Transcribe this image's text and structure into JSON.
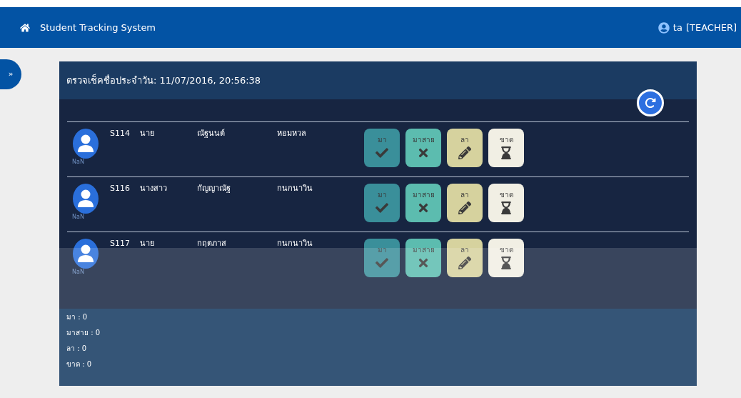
{
  "navbar": {
    "title": "Student Tracking System",
    "user": "ta",
    "role": "[TEACHER]"
  },
  "sidebar_toggle": {
    "label": "»"
  },
  "card": {
    "title": "ตรวจเช็คชื่อประจำวัน: 11/07/2016, 20:56:38"
  },
  "students": [
    {
      "id": "S114",
      "prefix": "นาย",
      "first_name": "ณัฐนนต์",
      "last_name": "หอมหวล",
      "avatar_caption": "NaN",
      "actions": [
        {
          "kind": "present",
          "label": "มา"
        },
        {
          "kind": "late",
          "label": "มาสาย"
        },
        {
          "kind": "leave",
          "label": "ลา"
        },
        {
          "kind": "absent",
          "label": "ขาด"
        }
      ]
    },
    {
      "id": "S116",
      "prefix": "นางสาว",
      "first_name": "กัญญาณัฐ",
      "last_name": "กนกนาวิน",
      "avatar_caption": "NaN",
      "actions": [
        {
          "kind": "present",
          "label": "มา"
        },
        {
          "kind": "late",
          "label": "มาสาย"
        },
        {
          "kind": "leave",
          "label": "ลา"
        },
        {
          "kind": "absent",
          "label": "ขาด"
        }
      ]
    },
    {
      "id": "S117",
      "prefix": "นาย",
      "first_name": "กฤตภาส",
      "last_name": "กนกนาวิน",
      "avatar_caption": "NaN",
      "actions": [
        {
          "kind": "present",
          "label": "มา"
        },
        {
          "kind": "late",
          "label": "มาสาย"
        },
        {
          "kind": "leave",
          "label": "ลา"
        },
        {
          "kind": "absent",
          "label": "ขาด"
        }
      ]
    }
  ],
  "summary": [
    "มา : 0",
    "มาสาย : 0",
    "ลา : 0",
    "ขาด : 0"
  ]
}
